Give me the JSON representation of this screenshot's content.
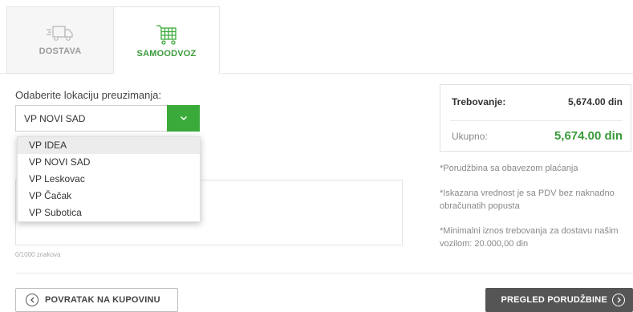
{
  "tabs": [
    {
      "label": "DOSTAVA",
      "icon": "delivery-truck-icon",
      "active": false
    },
    {
      "label": "SAMOODVOZ",
      "icon": "shopping-cart-icon",
      "active": true
    }
  ],
  "location": {
    "label": "Odaberite lokaciju preuzimanja:",
    "selected": "VP NOVI SAD",
    "options": [
      "VP IDEA",
      "VP NOVI SAD",
      "VP Leskovac",
      "VP Čačak",
      "VP Subotica"
    ]
  },
  "comment": {
    "char_count": "0/1000 znakova"
  },
  "summary": {
    "trebovanje_label": "Trebovanje:",
    "trebovanje_value": "5,674.00 din",
    "ukupno_label": "Ukupno:",
    "ukupno_value": "5,674.00 din"
  },
  "notes": [
    "*Porudžbina sa obavezom plaćanja",
    "*Iskazana vrednost je sa PDV bez naknadno obračunatih popusta",
    "*Minimalni iznos trebovanja za dostavu našim vozilom: 20.000,00 din"
  ],
  "buttons": {
    "back": "POVRATAK NA KUPOVINU",
    "review": "PREGLED PORUDŽBINE"
  },
  "colors": {
    "accent": "#3aaa3a",
    "dark_button": "#555555"
  }
}
